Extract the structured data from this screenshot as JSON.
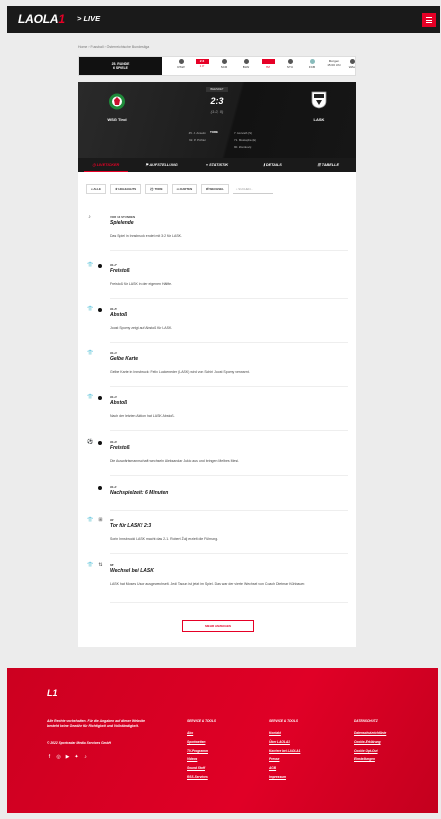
{
  "header": {
    "logo": "LAOLA",
    "logo_mark": "1",
    "section": "> LIVE"
  },
  "breadcrumb": [
    "Home",
    "Fussball",
    "Österreichische Bundesliga"
  ],
  "match_strip": {
    "first": {
      "line1": "25. RUNDE",
      "line2": "6 SPIELE"
    },
    "matches": [
      {
        "home": "RSW",
        "away": "RSW",
        "score": ""
      },
      {
        "home": "WSG",
        "away": "LASK",
        "score": "2:3",
        "time": "1 P"
      },
      {
        "home": "SCR",
        "away": "SVZ",
        "score": ""
      },
      {
        "home": "BLW",
        "away": "WAC",
        "score": ""
      },
      {
        "home": "RBS",
        "away": "TSV",
        "score": "",
        "time": "HZ"
      },
      {
        "home": "STU",
        "away": "ADM",
        "score": ""
      },
      {
        "home": "FCB",
        "away": "",
        "score": ""
      },
      {
        "home": "Morgen",
        "away": "15:00 Uhr",
        "score": ""
      },
      {
        "home": "WAL",
        "away": "",
        "score": ""
      }
    ]
  },
  "scoreboard": {
    "status": "BEENDET",
    "score": "2:3",
    "minute": "(1:2, 0)",
    "home_team": "WSG Tirol",
    "away_team": "LASK",
    "goals_label": "TORE",
    "home_goals": [
      "45. J. Anselm",
      "92. P. Pichler"
    ],
    "away_goals": [
      "7. Horvath (S)",
      "71. Mustapha (E)",
      "90. Zrenkoviç"
    ]
  },
  "tabs": [
    "LIVETICKER",
    "AUFSTELLUNG",
    "STATISTIK",
    "DETAILS",
    "TABELLE"
  ],
  "filters": [
    "ALLE",
    "HIGHLIGHTS",
    "TORE",
    "KARTEN",
    "WECHSEL"
  ],
  "search_placeholder": "SUCHEN...",
  "events": [
    {
      "minute": "VOR 13 STUNDEN",
      "title": "Spielende",
      "desc": "Das Spiel in Innsbruck endet mit 3:2 für LASK.",
      "icon": "whistle-icon",
      "dot": false
    },
    {
      "minute": "90+7'",
      "title": "Freistoß",
      "desc": "Freistoß für LASK in der eigenen Hälfte.",
      "icon": "shirt-icon",
      "dot": true
    },
    {
      "minute": "90+5'",
      "title": "Abstoß",
      "desc": "Joost Spomy zeigt auf Abstoß für LASK.",
      "icon": "shirt-icon",
      "dot": true
    },
    {
      "minute": "90+4'",
      "title": "Gelbe Karte",
      "desc": "Gelbe Karte in Innsbruck: Felix Luckeneder (LASK) wird von Schiri Joost Spomy verwarnt.",
      "icon": "shirt-icon",
      "dot": false
    },
    {
      "minute": "90+4'",
      "title": "Abstoß",
      "desc": "Nach der letzten Aktion hat LASK Abstoß.",
      "icon": "shirt-icon",
      "dot": true
    },
    {
      "minute": "90+3'",
      "title": "Freistoß",
      "desc": "Die Auswärtsmannschaft wechseln Aleksandar Jukic aus und bringen Melbes Mesi.",
      "icon": "ball-icon",
      "dot": true
    },
    {
      "minute": "90+1'",
      "title": "Nachspielzeit: 6 Minuten",
      "desc": "",
      "icon": "",
      "dot": true
    },
    {
      "minute": "90'",
      "title": "Tor für LASK! 2:3",
      "desc": "Sorin Innsbrucki LASK macht das 2-1. Robert Žulj erzielt die Führung.",
      "icon": "shirt-icon",
      "dot": false,
      "extra": "goal-net-icon"
    },
    {
      "minute": "88'",
      "title": "Wechsel bei LASK",
      "desc": "LASK hat Moses Usor ausgewechselt. Jedi Taoun ist jetzt im Spiel. Das war der vierte Wechsel von Coach Dietmar Kühbauer.",
      "icon": "shirt-icon",
      "dot": false,
      "extra": "swap-icon"
    }
  ],
  "more_button": "MEHR ANZEIGEN",
  "footer": {
    "logo": "L1",
    "legal": "Alle Rechte vorbehalten. Für die Angaben auf dieser Website besteht keine Gewähr für Richtigkeit und Vollständigkeit.",
    "copyright": "© 2022 Sportradar Media Services GmbH",
    "columns": [
      {
        "heading": "SERVICE & TOOLS",
        "links": [
          "Abo",
          "Sportwetten",
          "TV-Programm",
          "Videos",
          "Sound Stoff",
          "RSS-Services"
        ]
      },
      {
        "heading": "SERVICE & TOOLS",
        "links": [
          "Kontakt",
          "Über LAOLA1",
          "Karriere bei LAOLA1",
          "Presse",
          "AGB",
          "Impressum"
        ]
      },
      {
        "heading": "DATENSCHUTZ",
        "links": [
          "Datenschutzrichtlinie",
          "Cookie-Erklärung",
          "Cookie Opt-Out",
          "Einstellungen"
        ]
      }
    ]
  },
  "colors": {
    "brand_red": "#e60026",
    "dark": "#1a1a1a"
  }
}
